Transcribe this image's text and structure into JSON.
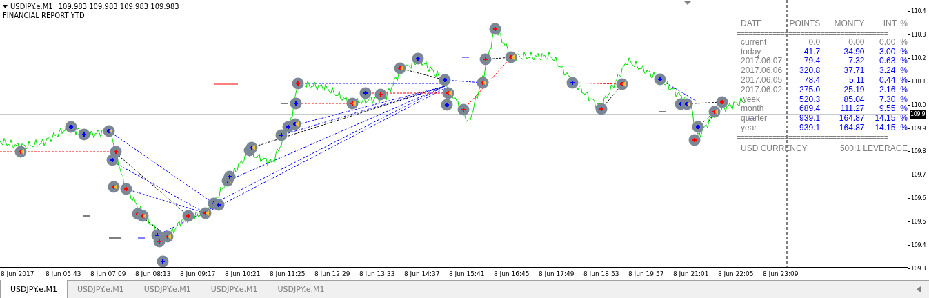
{
  "chart": {
    "symbol": "USDJPY.e,M1",
    "quotes": "109.983 109.983 109.983 109.983",
    "subtitle": "FINANCIAL REPORT YTD"
  },
  "report": {
    "columns": [
      "DATE",
      "POINTS",
      "MONEY",
      "INT. %"
    ],
    "separator": "======================================",
    "rows": [
      {
        "label": "current",
        "points": "0.0",
        "money": "0.00",
        "pct": "0.00",
        "unit": "%",
        "color": "#808080"
      },
      {
        "label": "today",
        "points": "41.7",
        "money": "34.90",
        "pct": "3.00",
        "unit": "%",
        "color": "#0000ff"
      },
      {
        "label": "2017.06.07",
        "points": "79.4",
        "money": "7.32",
        "pct": "0.63",
        "unit": "%",
        "color": "#0000ff"
      },
      {
        "label": "2017.06.06",
        "points": "320.8",
        "money": "37.71",
        "pct": "3.24",
        "unit": "%",
        "color": "#0000ff"
      },
      {
        "label": "2017.06.05",
        "points": "78.4",
        "money": "5.11",
        "pct": "0.44",
        "unit": "%",
        "color": "#0000ff"
      },
      {
        "label": "2017.06.02",
        "points": "275.0",
        "money": "25.19",
        "pct": "2.16",
        "unit": "%",
        "color": "#0000ff"
      },
      {
        "label": "week",
        "points": "520.3",
        "money": "85.04",
        "pct": "7.30",
        "unit": "%",
        "color": "#0000ff"
      },
      {
        "label": "month",
        "points": "689.4",
        "money": "111.27",
        "pct": "9.55",
        "unit": "%",
        "color": "#0000ff"
      },
      {
        "label": "quarter",
        "points": "939.1",
        "money": "164.87",
        "pct": "14.15",
        "unit": "%",
        "color": "#0000ff"
      },
      {
        "label": "year",
        "points": "939.1",
        "money": "164.87",
        "pct": "14.15",
        "unit": "%",
        "color": "#0000ff"
      }
    ],
    "footer_left": "USD CURRENCY",
    "footer_right": "500:1 LEVERAGE"
  },
  "price_axis": [
    {
      "label": "110.4",
      "kind": "tick"
    },
    {
      "label": "110.3",
      "kind": "tick"
    },
    {
      "label": "110.2",
      "kind": "tick"
    },
    {
      "label": "110.1",
      "kind": "tick"
    },
    {
      "label": "110.0",
      "kind": "tick"
    },
    {
      "label": "109.9",
      "kind": "price"
    },
    {
      "label": "109.9",
      "kind": "tick"
    },
    {
      "label": "109.8",
      "kind": "tick"
    },
    {
      "label": "109.7",
      "kind": "tick"
    },
    {
      "label": "109.6",
      "kind": "tick"
    },
    {
      "label": "109.5",
      "kind": "tick"
    },
    {
      "label": "109.4",
      "kind": "tick"
    },
    {
      "label": "109.3",
      "kind": "tick"
    }
  ],
  "time_axis": [
    "8 Jun 2017",
    "8 Jun 05:43",
    "8 Jun 07:09",
    "8 Jun 08:13",
    "8 Jun 09:17",
    "8 Jun 10:21",
    "8 Jun 11:25",
    "8 Jun 12:29",
    "8 Jun 13:33",
    "8 Jun 14:37",
    "8 Jun 15:41",
    "8 Jun 16:45",
    "8 Jun 17:49",
    "8 Jun 18:53",
    "8 Jun 19:57",
    "8 Jun 21:01",
    "8 Jun 22:05",
    "8 Jun 23:09"
  ],
  "tabs": [
    {
      "label": "USDJPY.e,M1",
      "selected": true
    },
    {
      "label": "USDJPY.e,M1",
      "selected": false
    },
    {
      "label": "USDJPY.e,M1",
      "selected": false
    },
    {
      "label": "USDJPY.e,M1",
      "selected": false
    },
    {
      "label": "USDJPY.e,M1",
      "selected": false
    }
  ]
}
